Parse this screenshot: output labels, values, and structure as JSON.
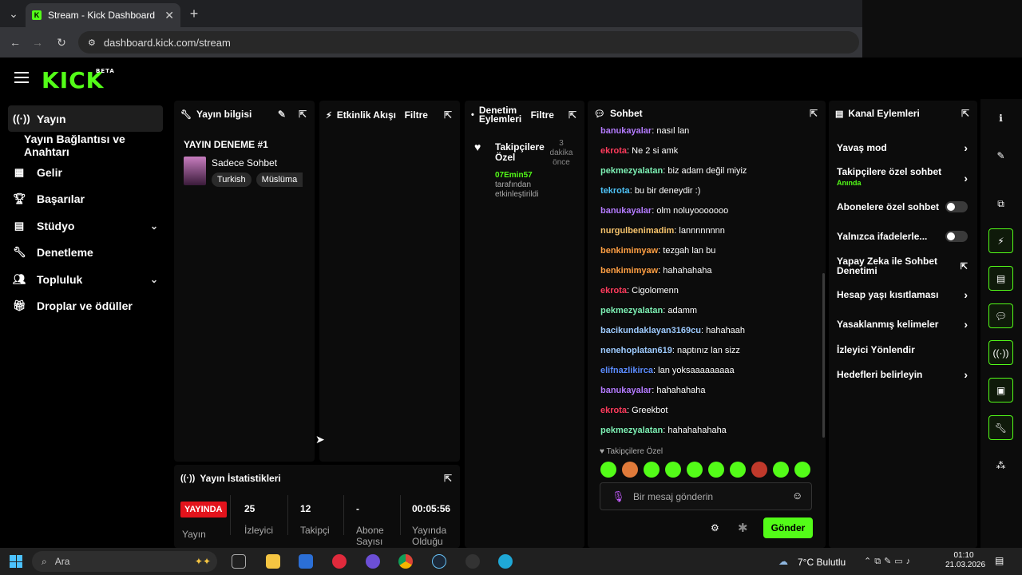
{
  "browser": {
    "tab_title": "Stream - Kick Dashboard",
    "url": "dashboard.kick.com/stream"
  },
  "header": {
    "logo": "KICK",
    "beta": "BETA"
  },
  "sidebar": {
    "items": [
      {
        "label": "Yayın",
        "icon": "broadcast-icon"
      },
      {
        "label": "Yayın Bağlantısı ve Anahtarı"
      },
      {
        "label": "Gelir",
        "icon": "chart-icon"
      },
      {
        "label": "Başarılar",
        "icon": "trophy-icon"
      },
      {
        "label": "Stüdyo",
        "icon": "studio-icon"
      },
      {
        "label": "Denetleme",
        "icon": "wrench-icon"
      },
      {
        "label": "Topluluk",
        "icon": "people-icon"
      },
      {
        "label": "Droplar ve ödüller",
        "icon": "gift-icon"
      }
    ]
  },
  "yayin_bilgisi": {
    "title": "Yayın bilgisi",
    "stream_title": "YAYIN DENEME #1",
    "category": "Sadece Sohbet",
    "tags": [
      "Turkish",
      "Müslüma"
    ]
  },
  "etkinlik": {
    "title": "Etkinlik Akışı",
    "filter": "Filtre"
  },
  "denetim": {
    "title": "Denetim Eylemleri",
    "filter": "Filtre",
    "event_title": "Takipçilere Özel",
    "event_user": "07Emin57",
    "event_desc": "tarafından etkinleştirildi",
    "event_time": "3 dakika önce"
  },
  "sohbet": {
    "title": "Sohbet",
    "messages": [
      {
        "user": "banukayalar",
        "text": "nasıl lan",
        "color": "#b47bff"
      },
      {
        "user": "ekrota",
        "text": "Ne 2 si amk",
        "color": "#ff3b5c"
      },
      {
        "user": "pekmezyalatan",
        "text": "biz adam değil miyiz",
        "color": "#7df0b4"
      },
      {
        "user": "tekrota",
        "text": "bu bir deneydir :)",
        "color": "#4fc3f7"
      },
      {
        "user": "banukayalar",
        "text": "olm noluyooooooo",
        "color": "#b47bff"
      },
      {
        "user": "nurgulbenimadim",
        "text": "lannnnnnnn",
        "color": "#f5c26b"
      },
      {
        "user": "benkimimyaw",
        "text": "tezgah lan bu",
        "color": "#ff9f43"
      },
      {
        "user": "benkimimyaw",
        "text": "hahahahaha",
        "color": "#ff9f43"
      },
      {
        "user": "ekrota",
        "text": "Cigolomenn",
        "color": "#ff3b5c"
      },
      {
        "user": "pekmezyalatan",
        "text": "adamm",
        "color": "#7df0b4"
      },
      {
        "user": "bacikundaklayan3169cu",
        "text": "hahahaah",
        "color": "#9ecbff"
      },
      {
        "user": "nenehoplatan619",
        "text": "naptınız lan sizz",
        "color": "#9ecbff"
      },
      {
        "user": "elifnazlikirca",
        "text": "lan yoksaaaaaaaaa",
        "color": "#5b8cff"
      },
      {
        "user": "banukayalar",
        "text": "hahahahaha",
        "color": "#b47bff"
      },
      {
        "user": "ekrota",
        "text": "Greekbot",
        "color": "#ff3b5c"
      },
      {
        "user": "pekmezyalatan",
        "text": "hahahahahaha",
        "color": "#7df0b4"
      }
    ],
    "mode": "Takipçilere Özel",
    "placeholder": "Bir mesaj gönderin",
    "send": "Gönder"
  },
  "kanal": {
    "title": "Kanal Eylemleri",
    "items": [
      {
        "label": "Yavaş mod"
      },
      {
        "label": "Takipçilere özel sohbet",
        "sub": "Anında"
      },
      {
        "label": "Abonelere özel sohbet"
      },
      {
        "label": "Yalnızca ifadelerle..."
      },
      {
        "label": "Yapay Zeka ile Sohbet Denetimi"
      },
      {
        "label": "Hesap yaşı kısıtlaması"
      },
      {
        "label": "Yasaklanmış kelimeler"
      },
      {
        "label": "İzleyici Yönlendir"
      },
      {
        "label": "Hedefleri belirleyin"
      }
    ]
  },
  "istatistik": {
    "title": "Yayın İstatistikleri",
    "live": "YAYINDA",
    "live_label": "Yayın",
    "viewers": "25",
    "viewers_label": "İzleyici",
    "followers": "12",
    "followers_label": "Takipçi",
    "subs": "-",
    "subs_label": "Abone Sayısı",
    "uptime": "00:05:56",
    "uptime_label": "Yayında Olduğu"
  },
  "taskbar": {
    "search": "Ara",
    "weather": "7°C Bulutlu",
    "time": "01:10",
    "date": "21.03.2026"
  },
  "colors": {
    "accent": "#53fc18",
    "live": "#e3131c"
  }
}
